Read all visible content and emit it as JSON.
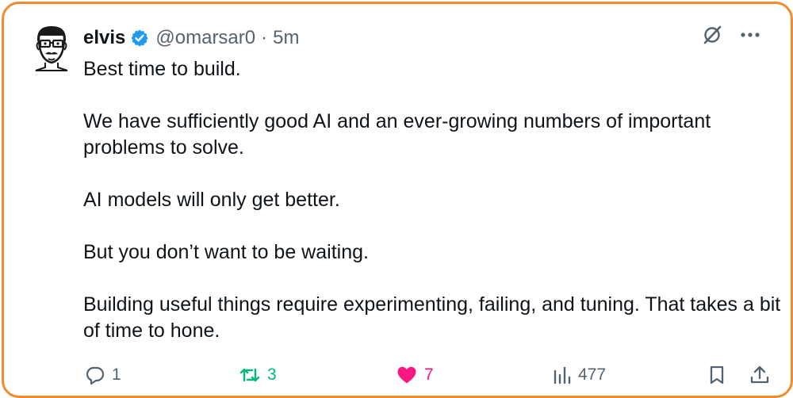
{
  "tweet": {
    "author_name": "elvis",
    "handle": "@omarsar0",
    "separator": "·",
    "time_ago": "5m",
    "paragraphs": [
      "Best time to build.",
      "We have sufficiently good AI and an ever-growing numbers of important problems to solve.",
      "AI models will only get better.",
      "But you don’t want to be waiting.",
      "Building useful things require experimenting, failing, and tuning. That takes a bit of time to hone."
    ]
  },
  "actions": {
    "replies": "1",
    "retweets": "3",
    "likes": "7",
    "views": "477"
  },
  "icons": {
    "verified": "verified-badge-icon",
    "grok": "grok-icon",
    "more": "more-icon",
    "reply": "reply-icon",
    "retweet": "retweet-icon",
    "like": "heart-icon",
    "views": "views-icon",
    "bookmark": "bookmark-icon",
    "share": "share-icon"
  },
  "colors": {
    "frame_border": "#f28a2e",
    "verified": "#1d9bf0",
    "retweet": "#00ba7c",
    "like": "#f91880",
    "muted": "#536471",
    "text": "#0f1419"
  }
}
